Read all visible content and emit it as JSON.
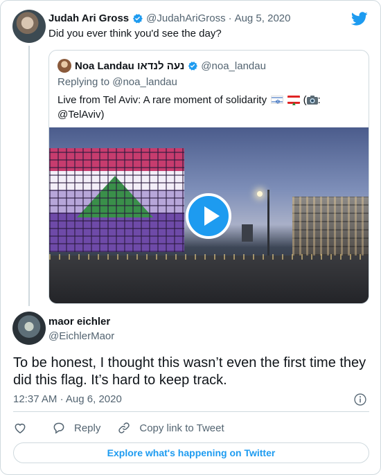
{
  "parent_tweet": {
    "name": "Judah Ari Gross",
    "handle": "@JudahAriGross",
    "separator": "·",
    "date": "Aug 5, 2020",
    "text": "Did you ever think you'd see the day?"
  },
  "quoted_tweet": {
    "name": "Noa Landau נעה לנדאו",
    "handle": "@noa_landau",
    "reply_prefix": "Replying to ",
    "reply_to": "@noa_landau",
    "text_main": "Live from Tel Aviv: A rare moment of solidarity",
    "text_paren_open": " (",
    "text_paren_tail": ":",
    "text_credit": "@TelAviv)"
  },
  "reply_tweet": {
    "name": "maor eichler",
    "handle": "@EichlerMaor",
    "text": "To be honest, I thought this wasn’t even the first time they did this flag. It’s hard to keep track.",
    "time": "12:37 AM",
    "separator": "·",
    "date": "Aug 6, 2020"
  },
  "actions": {
    "reply_label": "Reply",
    "copy_link_label": "Copy link to Tweet"
  },
  "explore_label": "Explore what's happening on Twitter",
  "icons": {
    "brand": "twitter-bird-icon",
    "verified": "verified-badge-icon",
    "like": "heart-icon",
    "reply": "reply-bubble-icon",
    "copy_link": "link-icon",
    "info": "info-icon",
    "play": "play-icon"
  },
  "colors": {
    "twitter_blue": "#1d9bf0",
    "text_primary": "#0f1419",
    "text_secondary": "#536471",
    "border": "#cfd9de"
  }
}
